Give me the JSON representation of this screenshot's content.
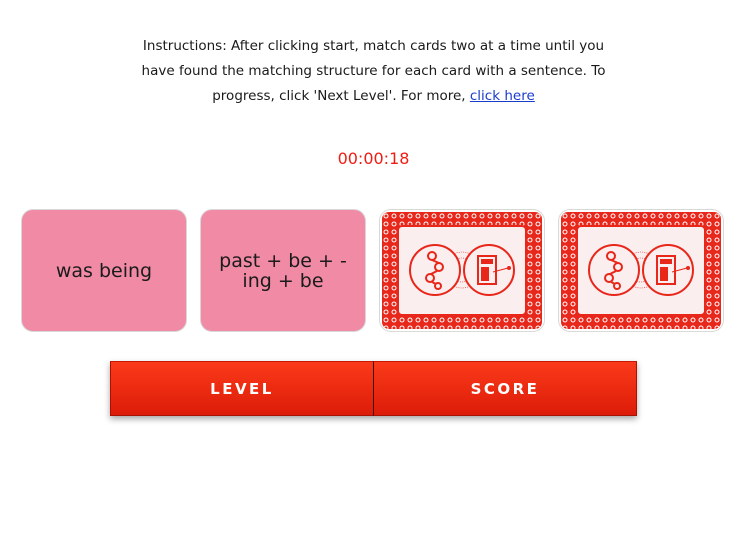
{
  "instructions": {
    "text": "Instructions: After clicking start, match cards two at a time until you have found the matching structure for each card with a sentence. To progress, click 'Next Level'. For more, ",
    "link_label": "click here"
  },
  "timer": "00:00:18",
  "cards": [
    {
      "state": "face-up",
      "text": "was being"
    },
    {
      "state": "face-up",
      "text": "past + be + -ing + be"
    },
    {
      "state": "face-down",
      "back_icon": "card-back-logo-icon"
    },
    {
      "state": "face-down",
      "back_icon": "card-back-logo-icon"
    }
  ],
  "controls": {
    "level_label": "LEVEL",
    "score_label": "SCORE"
  },
  "colors": {
    "accent_red": "#ee1d14",
    "card_face_pink": "#f08aa5",
    "button_red": "#f02a10"
  }
}
